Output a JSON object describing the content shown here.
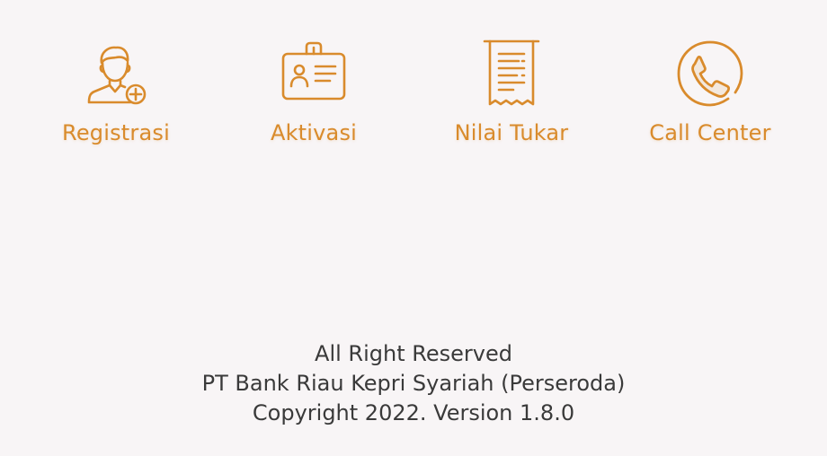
{
  "colors": {
    "background": "#f8f5f6",
    "accent": "#d98b2c",
    "footer_text": "#3a3a3a"
  },
  "menu": [
    {
      "label": "Registrasi",
      "icon": "user-add-icon"
    },
    {
      "label": "Aktivasi",
      "icon": "id-card-icon"
    },
    {
      "label": "Nilai Tukar",
      "icon": "receipt-icon"
    },
    {
      "label": "Call Center",
      "icon": "phone-icon"
    }
  ],
  "footer": {
    "line1": "All Right Reserved",
    "line2": "PT Bank Riau Kepri Syariah (Perseroda)",
    "line3": "Copyright 2022. Version 1.8.0"
  }
}
